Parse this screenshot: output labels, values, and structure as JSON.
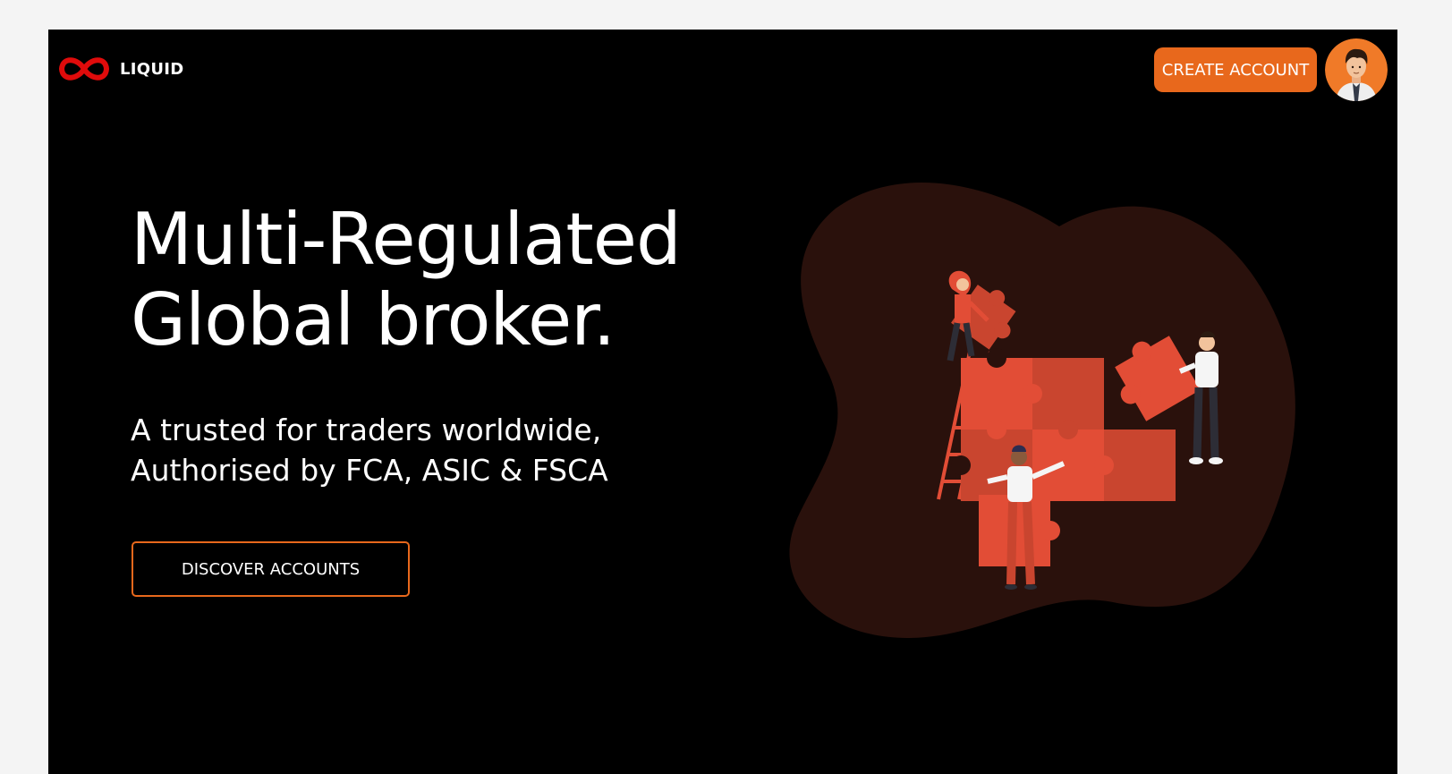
{
  "header": {
    "brand_name": "LIQUID",
    "logo_icon": "infinity-icon",
    "create_account_label": "CREATE ACCOUNT",
    "avatar_icon": "user-avatar-icon"
  },
  "hero": {
    "title_line1": "Multi-Regulated",
    "title_line2": "Global broker.",
    "subtitle_line1": "A trusted for traders worldwide,",
    "subtitle_line2": "Authorised by FCA, ASIC & FSCA",
    "cta_label": "DISCOVER ACCOUNTS",
    "illustration_icon": "puzzle-team-illustration"
  },
  "colors": {
    "background": "#000000",
    "page_margin": "#f4f4f4",
    "accent": "#e8681c",
    "logo_red": "#e00b0b",
    "puzzle_red": "#e24d36",
    "blob": "#2a110c"
  }
}
